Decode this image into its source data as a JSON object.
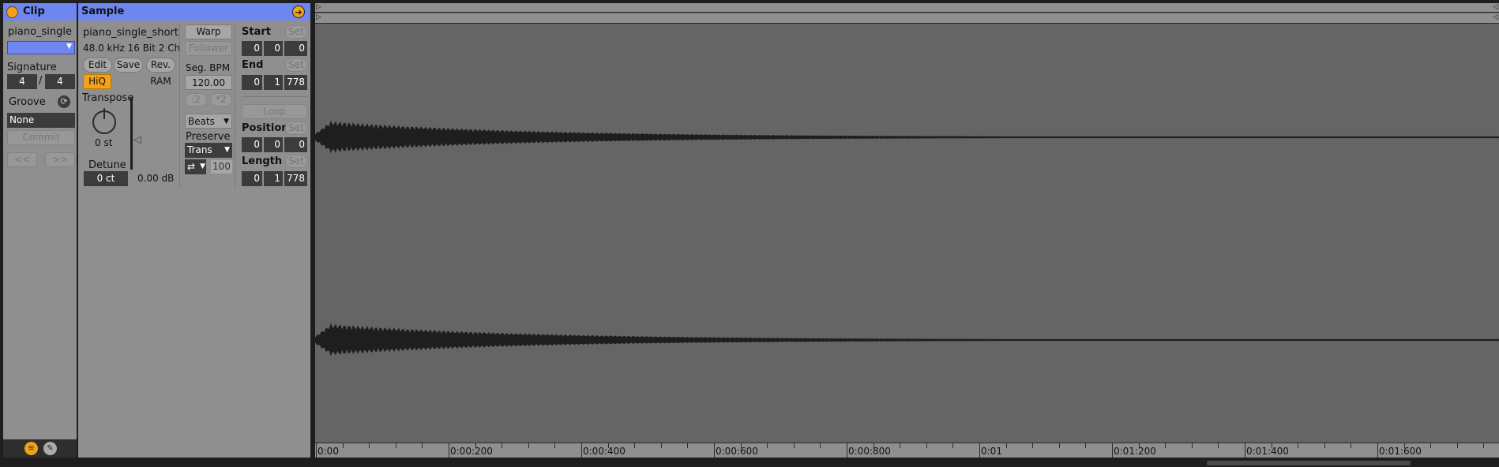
{
  "clip": {
    "title": "Clip",
    "name": "piano_single",
    "signature_label": "Signature",
    "sig_num": "4",
    "sig_sep": "/",
    "sig_den": "4",
    "groove_label": "Groove",
    "groove_value": "None",
    "commit_label": "Commit",
    "prev_label": "<<",
    "next_label": ">>"
  },
  "sample": {
    "title": "Sample",
    "filename": "piano_single_short",
    "format": "48.0 kHz 16 Bit 2 Ch",
    "edit_label": "Edit",
    "save_label": "Save",
    "rev_label": "Rev.",
    "hiq_label": "HiQ",
    "ram_label": "RAM",
    "transpose_label": "Transpose",
    "transpose_value": "0 st",
    "detune_label": "Detune",
    "detune_value": "0 ct",
    "gain_value": "0.00 dB"
  },
  "warp": {
    "warp_label": "Warp",
    "follower_label": "Follower",
    "segbpm_label": "Seg. BPM",
    "segbpm_value": "120.00",
    "half_label": ":2",
    "double_label": "*2",
    "mode_value": "Beats",
    "preserve_label": "Preserve",
    "preserve_value": "Trans",
    "loop_mode_icon": "⇄",
    "amount_value": "100"
  },
  "markers": {
    "start_label": "Start",
    "end_label": "End",
    "loop_label": "Loop",
    "position_label": "Position",
    "length_label": "Length",
    "set_label": "Set",
    "start": [
      "0",
      "0",
      "0"
    ],
    "end": [
      "0",
      "1",
      "778"
    ],
    "position": [
      "0",
      "0",
      "0"
    ],
    "length": [
      "0",
      "1",
      "778"
    ]
  },
  "ruler": {
    "labels": [
      "0:00",
      "0:00:200",
      "0:00:400",
      "0:00:600",
      "0:00:800",
      "0:01",
      "0:01:200",
      "0:01:400",
      "0:01:600"
    ]
  },
  "colors": {
    "accent": "#6e86f0",
    "orange": "#f1a21b",
    "panel": "#8f8f8f",
    "waveform_bg": "#656565"
  }
}
